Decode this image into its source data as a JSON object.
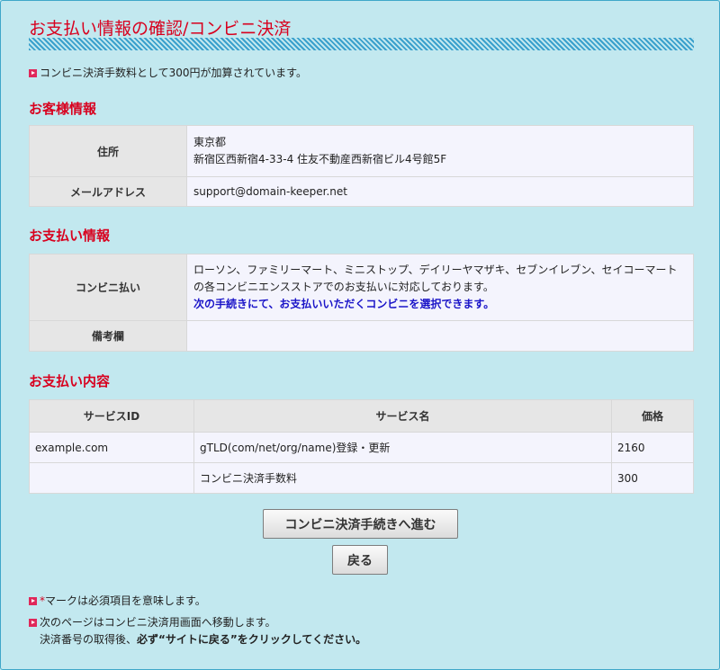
{
  "page": {
    "title": "お支払い情報の確認/コンビニ決済"
  },
  "notice_fee": "コンビニ決済手数料として300円が加算されています。",
  "customer": {
    "section_title": "お客様情報",
    "address_label": "住所",
    "address_line1": "東京都",
    "address_line2": "新宿区西新宿4-33-4 住友不動産西新宿ビル4号館5F",
    "email_label": "メールアドレス",
    "email_value": "support@domain-keeper.net"
  },
  "payment": {
    "section_title": "お支払い情報",
    "method_label": "コンビニ払い",
    "method_desc": "ローソン、ファミリーマート、ミニストップ、デイリーヤマザキ、セブンイレブン、セイコーマートの各コンビニエンスストアでのお支払いに対応しております。",
    "method_link": "次の手続きにて、お支払いいただくコンビニを選択できます。",
    "remarks_label": "備考欄",
    "remarks_value": ""
  },
  "details": {
    "section_title": "お支払い内容",
    "columns": [
      "サービスID",
      "サービス名",
      "価格"
    ],
    "rows": [
      {
        "service_id": "example.com",
        "service_name": "gTLD(com/net/org/name)登録・更新",
        "price": "2160"
      },
      {
        "service_id": "",
        "service_name": "コンビニ決済手数料",
        "price": "300"
      }
    ]
  },
  "buttons": {
    "proceed": "コンビニ決済手続きへ進む",
    "back": "戻る"
  },
  "footer_notes": {
    "required_mark": "*",
    "required_text": "マークは必須項目を意味します。",
    "next_page": "次のページはコンビニ決済用画面へ移動します。",
    "after_prefix": "決済番号の取得後、",
    "after_bold": "必ず“サイトに戻る”をクリックしてください。"
  },
  "colors": {
    "accent_red": "#d8001e",
    "link_blue": "#1a14c8",
    "background": "#c2e8ef"
  }
}
